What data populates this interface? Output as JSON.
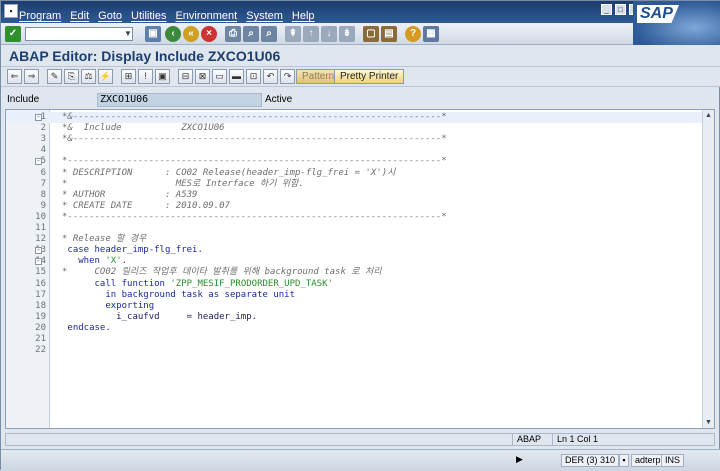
{
  "menu": [
    "Program",
    "Edit",
    "Goto",
    "Utilities",
    "Environment",
    "System",
    "Help"
  ],
  "logo_text": "SAP",
  "title": "ABAP Editor: Display Include ZXCO1U06",
  "app_buttons": {
    "pattern": "Pattern",
    "pretty_printer": "Pretty Printer"
  },
  "include": {
    "label": "Include",
    "value": "ZXCO1U06",
    "status": "Active"
  },
  "code_lines": [
    {
      "n": "1",
      "fold": "-",
      "text": "*&--------------------------------------------------------------------*",
      "style": "comment"
    },
    {
      "n": "2",
      "fold": "",
      "text": "*&  Include           ZXCO1U06",
      "style": "comment"
    },
    {
      "n": "3",
      "fold": "",
      "text": "*&--------------------------------------------------------------------*",
      "style": "comment"
    },
    {
      "n": "4",
      "fold": "",
      "text": "",
      "style": "plain"
    },
    {
      "n": "5",
      "fold": "-",
      "text": "*---------------------------------------------------------------------*",
      "style": "comment"
    },
    {
      "n": "6",
      "fold": "",
      "text": "* DESCRIPTION      : CO02 Release(header_imp-flg_frei = 'X')시",
      "style": "comment"
    },
    {
      "n": "7",
      "fold": "",
      "text": "*                    MES로 Interface 하기 위함.",
      "style": "comment"
    },
    {
      "n": "8",
      "fold": "",
      "text": "* AUTHOR           : A539",
      "style": "comment"
    },
    {
      "n": "9",
      "fold": "",
      "text": "* CREATE DATE      : 2010.09.07",
      "style": "comment"
    },
    {
      "n": "10",
      "fold": "",
      "text": "*---------------------------------------------------------------------*",
      "style": "comment"
    },
    {
      "n": "11",
      "fold": "",
      "text": "",
      "style": "plain"
    },
    {
      "n": "12",
      "fold": "",
      "text": "* Release 할 경우",
      "style": "comment"
    },
    {
      "n": "13",
      "fold": "-",
      "text": " case header_imp-flg_frei.",
      "style": "kw"
    },
    {
      "n": "14",
      "fold": "-",
      "text": "   when 'X'.",
      "style": "kw"
    },
    {
      "n": "15",
      "fold": "",
      "text": "*     CO02 릴리즈 작업후 데이타 발취를 위해 background task 로 처리",
      "style": "comment"
    },
    {
      "n": "16",
      "fold": "",
      "text": "      call function 'ZPP_MESIF_PRODORDER_UPD_TASK'",
      "style": "kw"
    },
    {
      "n": "17",
      "fold": "",
      "text": "        in background task as separate unit",
      "style": "kw"
    },
    {
      "n": "18",
      "fold": "",
      "text": "        exporting",
      "style": "kw"
    },
    {
      "n": "19",
      "fold": "",
      "text": "          i_caufvd     = header_imp.",
      "style": "plain"
    },
    {
      "n": "20",
      "fold": "",
      "text": " endcase.",
      "style": "kw"
    },
    {
      "n": "21",
      "fold": "",
      "text": "",
      "style": "plain"
    },
    {
      "n": "22",
      "fold": "",
      "text": "",
      "style": "plain"
    }
  ],
  "position": {
    "lang": "ABAP",
    "line": "Ln  1 Col  1"
  },
  "status": {
    "system": "DER (3) 310",
    "server": "adterp",
    "mode": "INS"
  }
}
